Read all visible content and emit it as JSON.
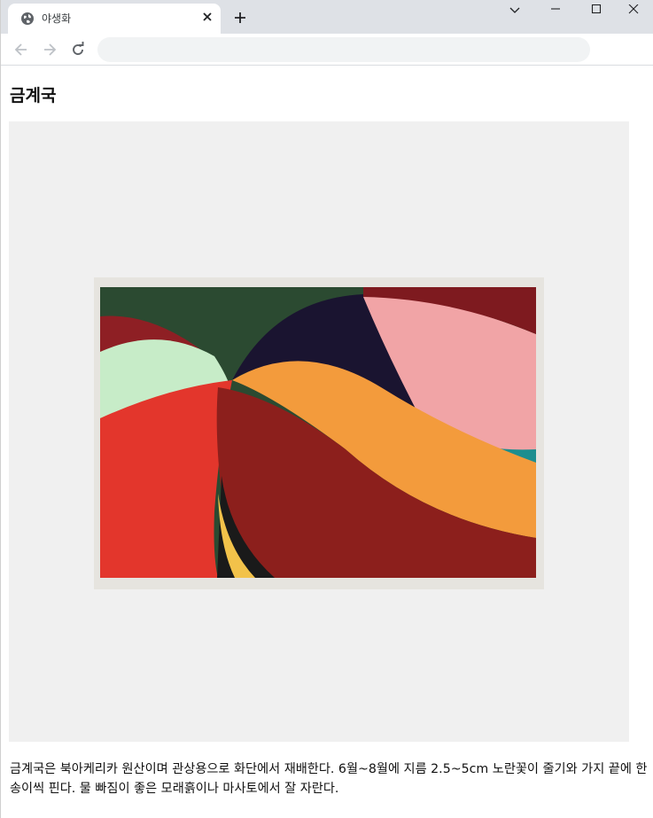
{
  "browser": {
    "tab_title": "야생화",
    "address_value": ""
  },
  "article": {
    "title": "금계국",
    "image_label": "금계국",
    "description": "금계국은 북아케리카 원산이며 관상용으로 화단에서 재배한다. 6월~8월에 지름 2.5~5cm 노란꽃이 줄기와 가지 끝에 한 송이씩 핀다. 물 빠짐이 좋은 모래흙이나 마사토에서 잘 자란다."
  },
  "colors": {
    "chrome": "#dee1e6",
    "omnibox": "#f1f3f4",
    "image_bg": "#f0f0f0"
  }
}
